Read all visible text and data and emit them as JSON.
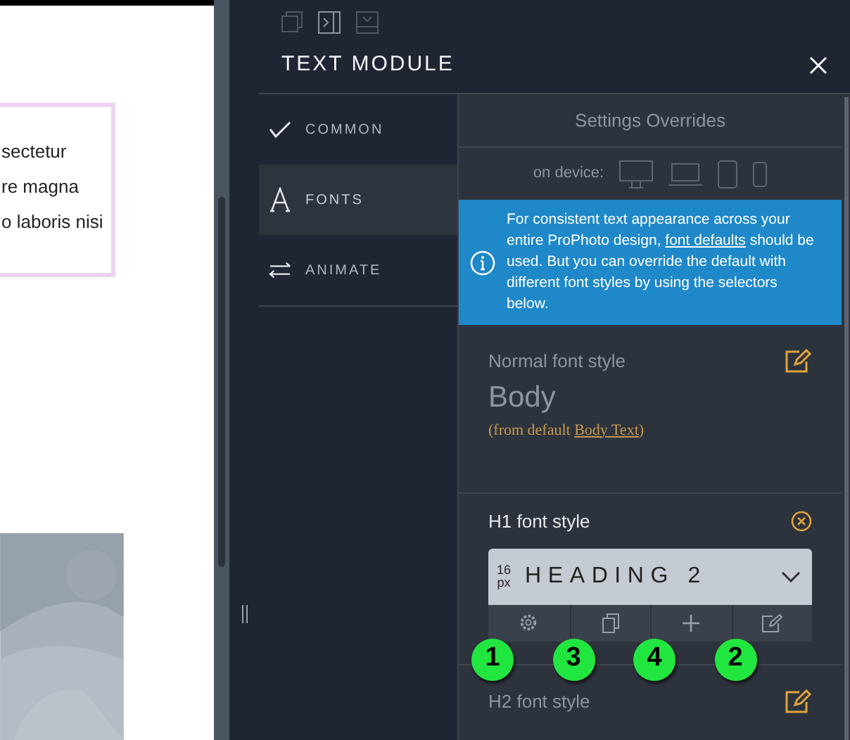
{
  "preview": {
    "lines": [
      "sectetur",
      "re magna",
      "o laboris nisi"
    ]
  },
  "panel": {
    "title": "TEXT MODULE",
    "nav": [
      {
        "label": "COMMON",
        "kind": "check",
        "selected": false
      },
      {
        "label": "FONTS",
        "kind": "font",
        "selected": true
      },
      {
        "label": "ANIMATE",
        "kind": "swap",
        "selected": false
      }
    ],
    "overrides": {
      "title": "Settings Overrides",
      "device_label": "on device:"
    },
    "info": {
      "before": "For consistent text appearance across your entire ProPhoto design,",
      "link": "font defaults",
      "after": "should be used. But you can override the default with different font styles by using the selectors below."
    },
    "styles": [
      {
        "kind": "summary",
        "label": "Normal font style",
        "value": "Body",
        "note_before": "(from default ",
        "note_link": "Body Text",
        "note_after": ")"
      },
      {
        "kind": "select",
        "label": "H1 font style",
        "size": "16",
        "unit": "px",
        "value": "HEADING 2",
        "tools": [
          {
            "kind": "gear",
            "callout": "1"
          },
          {
            "kind": "copy",
            "callout": "3"
          },
          {
            "kind": "plus",
            "callout": "4"
          },
          {
            "kind": "edit",
            "callout": "2"
          }
        ]
      },
      {
        "kind": "summary",
        "label": "H2 font style"
      }
    ]
  }
}
